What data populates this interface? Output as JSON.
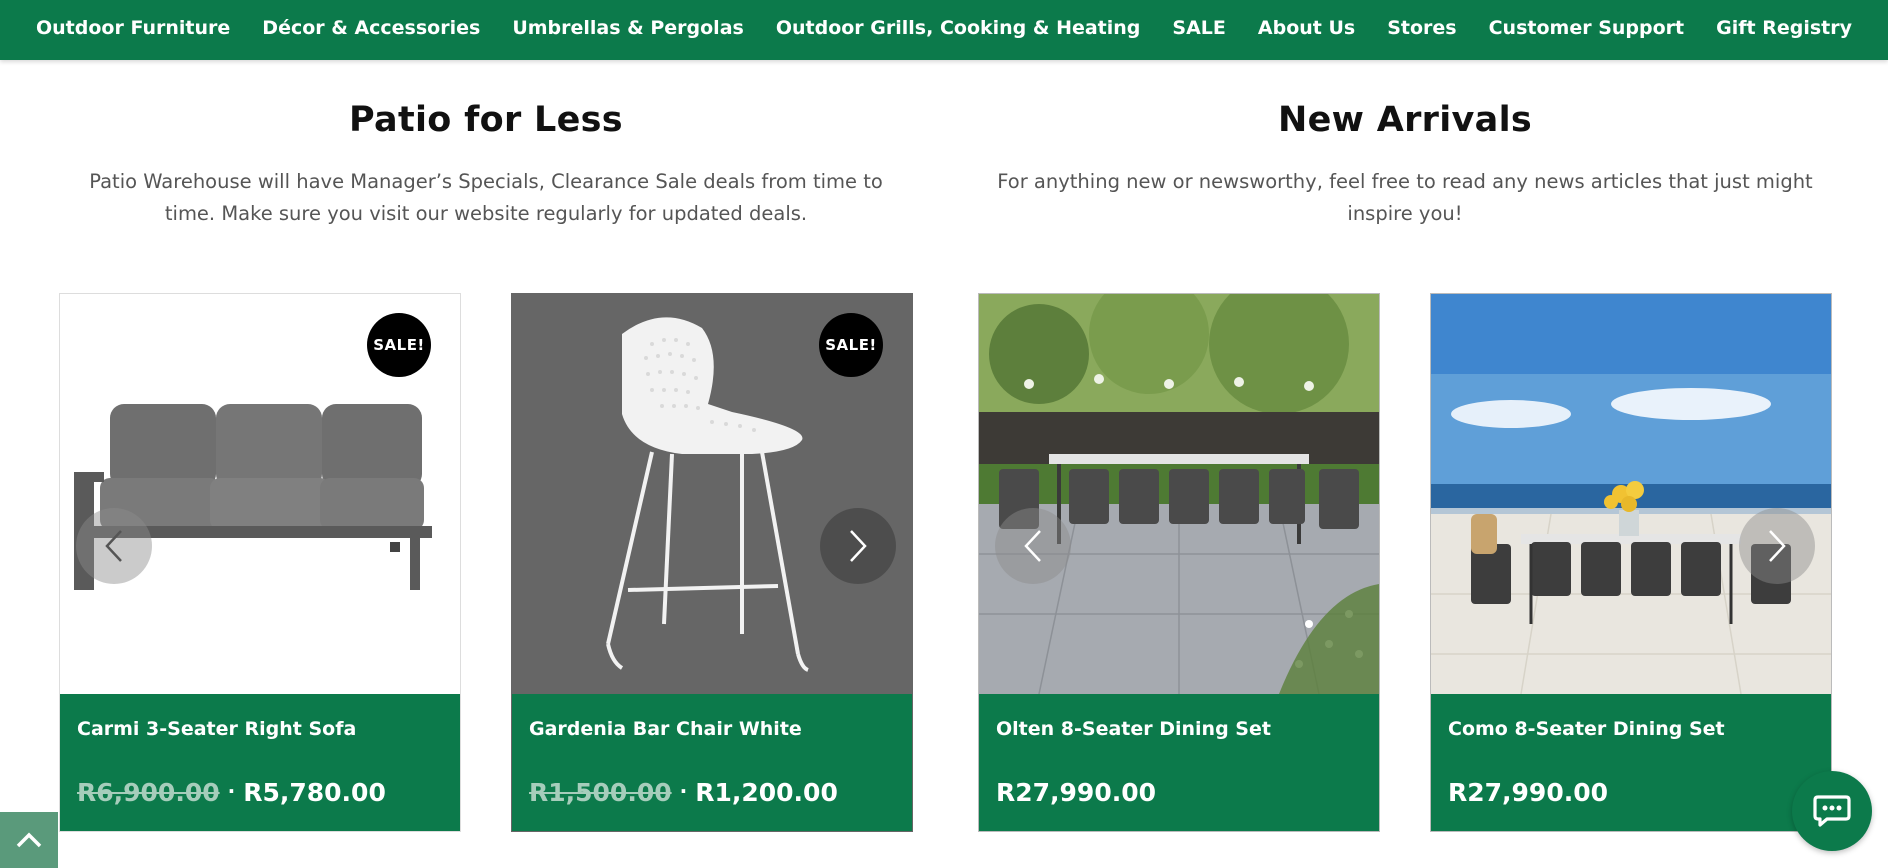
{
  "nav": {
    "items": [
      "Outdoor Furniture",
      "Décor & Accessories",
      "Umbrellas & Pergolas",
      "Outdoor Grills, Cooking & Heating",
      "SALE",
      "About Us",
      "Stores",
      "Customer Support",
      "Gift Registry"
    ]
  },
  "sections": {
    "patio": {
      "title": "Patio for Less",
      "text": "Patio Warehouse will have Manager’s Specials, Clearance Sale deals from time to time. Make sure you visit our website regularly for updated deals."
    },
    "arrivals": {
      "title": "New Arrivals",
      "text": "For anything new or newsworthy, feel free to read any news articles that just might inspire you!"
    }
  },
  "products": [
    {
      "name": "Carmi 3-Seater Right Sofa",
      "old_price": "R6,900.00",
      "price": "R5,780.00",
      "badge": "SALE!"
    },
    {
      "name": "Gardenia Bar Chair White",
      "old_price": "R1,500.00",
      "price": "R1,200.00",
      "badge": "SALE!"
    },
    {
      "name": "Olten 8-Seater Dining Set",
      "price": "R27,990.00"
    },
    {
      "name": "Como 8-Seater Dining Set",
      "price": "R27,990.00"
    }
  ],
  "icons": {
    "prev": "chevron-left-icon",
    "next": "chevron-right-icon",
    "scroll_top": "chevron-up-icon",
    "chat": "chat-bubble-icon"
  },
  "colors": {
    "brand_green": "#0c7a4b",
    "badge_black": "#000000"
  },
  "separator": "·"
}
